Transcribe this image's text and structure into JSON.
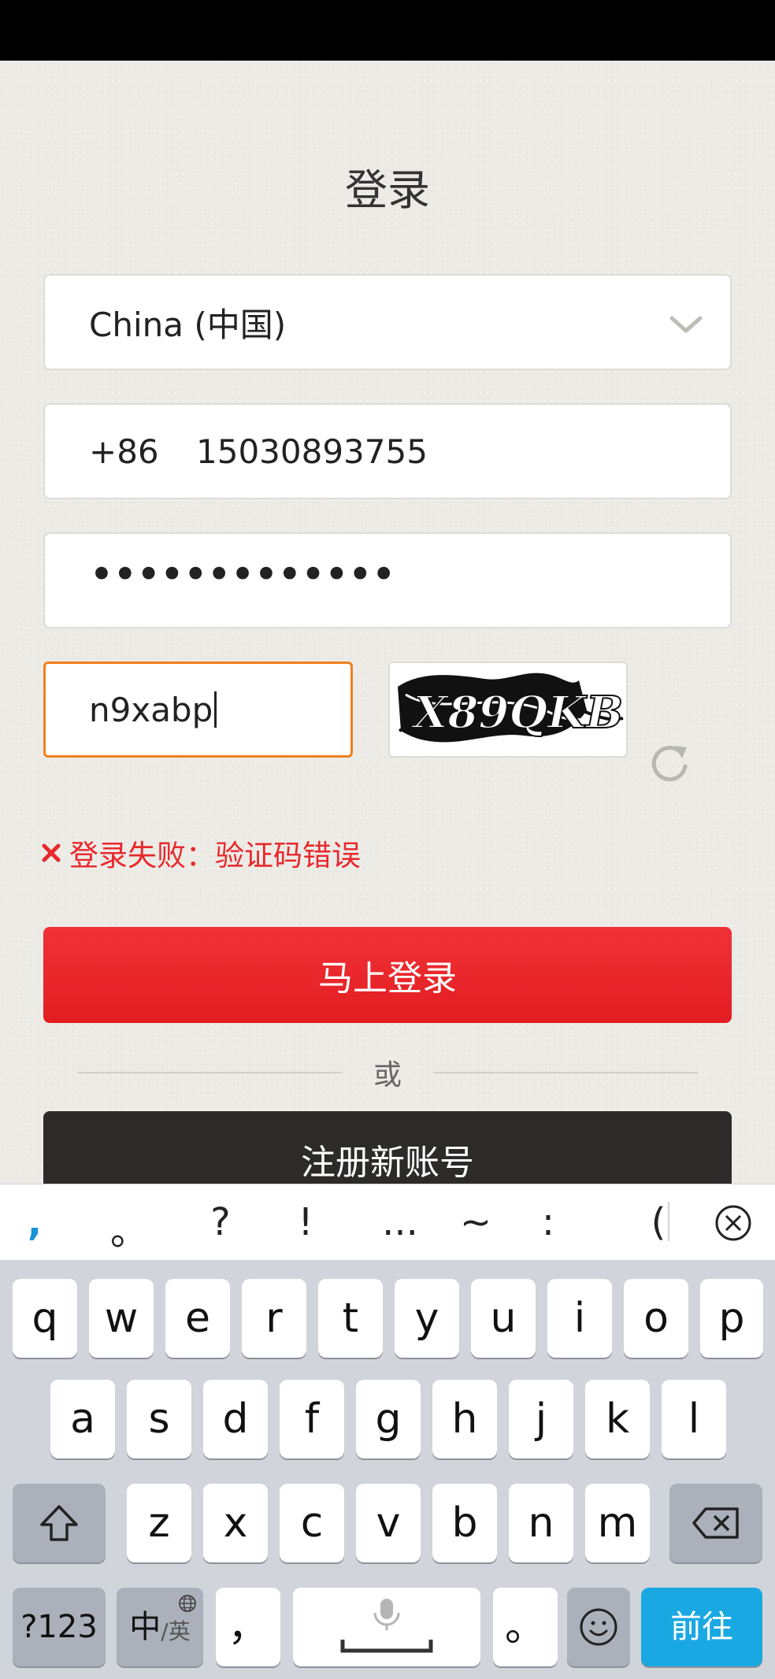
{
  "page": {
    "title": "登录"
  },
  "form": {
    "country": "China (中国)",
    "phone_prefix": "+86",
    "phone_number": "15030893755",
    "password_mask": "•••••••••••••",
    "captcha_value": "n9xabp",
    "captcha_image_text": "X89QKB",
    "error_message": "登录失败：验证码错误",
    "login_button": "马上登录",
    "or_text": "或",
    "register_button": "注册新账号"
  },
  "keyboard": {
    "punctuation": [
      ",",
      "。",
      "?",
      "!",
      "...",
      "~",
      ":",
      "("
    ],
    "row1": [
      "q",
      "w",
      "e",
      "r",
      "t",
      "y",
      "u",
      "i",
      "o",
      "p"
    ],
    "row2": [
      "a",
      "s",
      "d",
      "f",
      "g",
      "h",
      "j",
      "k",
      "l"
    ],
    "row3": [
      "z",
      "x",
      "c",
      "v",
      "b",
      "n",
      "m"
    ],
    "mode_key": "?123",
    "lang_key_main": "中",
    "lang_key_sub": "/英",
    "comma_key": "，",
    "period_key": "。",
    "go_key": "前往"
  },
  "colors": {
    "accent_red": "#e8282c",
    "login_red": "#e21d22",
    "focus_orange": "#f0801e",
    "register_dark": "#2d2a2a",
    "go_blue": "#1aa8e3"
  },
  "icons": {
    "country_dropdown": "chevron-down-icon",
    "captcha_refresh": "refresh-icon",
    "error": "close-x-icon",
    "keyboard_close": "circle-x-icon",
    "shift": "shift-arrow-icon",
    "backspace": "backspace-icon",
    "space": "microphone-icon",
    "emoji": "smiley-icon",
    "globe": "globe-icon"
  }
}
